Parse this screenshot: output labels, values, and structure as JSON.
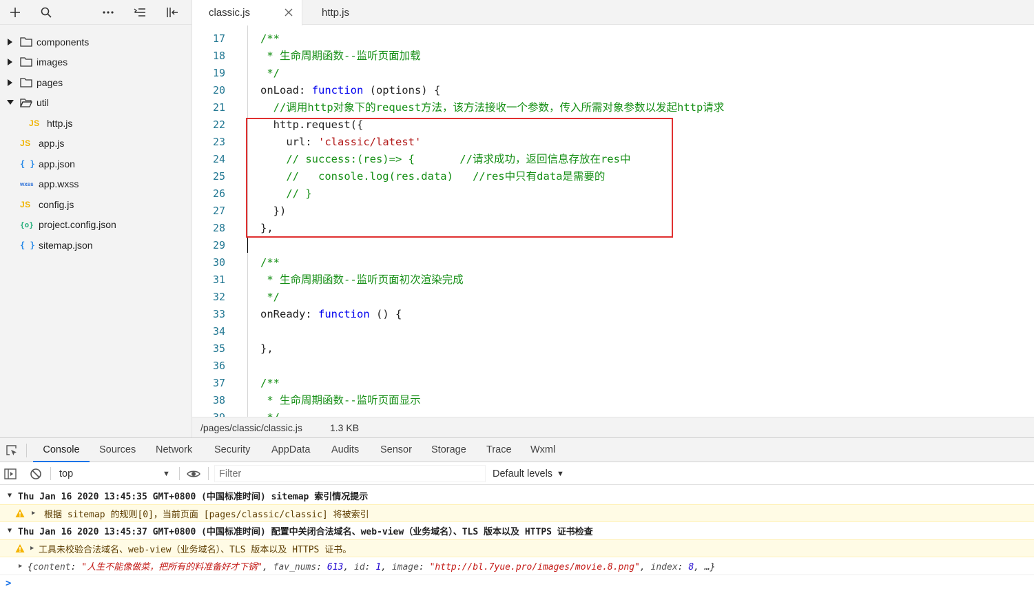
{
  "sidebar": {
    "toolbar": {
      "add": "add-icon",
      "search": "search-icon",
      "more": "more-icon",
      "collapse": "collapse-all-icon",
      "layout": "toggle-layout-icon"
    },
    "tree": [
      {
        "label": "components",
        "type": "folder",
        "depth": 0,
        "expanded": false
      },
      {
        "label": "images",
        "type": "folder",
        "depth": 0,
        "expanded": false
      },
      {
        "label": "pages",
        "type": "folder",
        "depth": 0,
        "expanded": false
      },
      {
        "label": "util",
        "type": "folder",
        "depth": 0,
        "expanded": true
      },
      {
        "label": "http.js",
        "type": "js",
        "depth": 1,
        "badge": "JS"
      },
      {
        "label": "app.js",
        "type": "js",
        "depth": 0,
        "badge": "JS"
      },
      {
        "label": "app.json",
        "type": "json",
        "depth": 0,
        "badge": "{ }"
      },
      {
        "label": "app.wxss",
        "type": "wxss",
        "depth": 0,
        "badge": "wxss"
      },
      {
        "label": "config.js",
        "type": "js",
        "depth": 0,
        "badge": "JS"
      },
      {
        "label": "project.config.json",
        "type": "cfg",
        "depth": 0,
        "badge": "{o}"
      },
      {
        "label": "sitemap.json",
        "type": "json",
        "depth": 0,
        "badge": "{ }"
      }
    ]
  },
  "editor": {
    "tabs": [
      {
        "label": "classic.js",
        "active": true
      },
      {
        "label": "http.js",
        "active": false
      }
    ],
    "lines": [
      {
        "n": "17",
        "tokens": [
          {
            "t": "/**",
            "c": "c-com"
          }
        ]
      },
      {
        "n": "18",
        "tokens": [
          {
            "t": " * 生命周期函数--监听页面加载",
            "c": "c-com"
          }
        ]
      },
      {
        "n": "19",
        "tokens": [
          {
            "t": " */",
            "c": "c-com"
          }
        ]
      },
      {
        "n": "20",
        "tokens": [
          {
            "t": "onLoad: ",
            "c": ""
          },
          {
            "t": "function",
            "c": "c-kw"
          },
          {
            "t": " (options) {",
            "c": ""
          }
        ]
      },
      {
        "n": "21",
        "tokens": [
          {
            "t": "  //调用http对象下的request方法，该方法接收一个参数，传入所需对象参数以发起http请求",
            "c": "c-com"
          }
        ]
      },
      {
        "n": "22",
        "tokens": [
          {
            "t": "  http.request({",
            "c": ""
          }
        ]
      },
      {
        "n": "23",
        "tokens": [
          {
            "t": "    url: ",
            "c": ""
          },
          {
            "t": "'classic/latest'",
            "c": "c-str"
          }
        ]
      },
      {
        "n": "24",
        "tokens": [
          {
            "t": "    // success:(res)=> {       //请求成功，返回信息存放在res中",
            "c": "c-com"
          }
        ]
      },
      {
        "n": "25",
        "tokens": [
          {
            "t": "    //   console.log(res.data)   //res中只有data是需要的",
            "c": "c-com"
          }
        ]
      },
      {
        "n": "26",
        "tokens": [
          {
            "t": "    // }",
            "c": "c-com"
          }
        ]
      },
      {
        "n": "27",
        "tokens": [
          {
            "t": "  })",
            "c": ""
          }
        ]
      },
      {
        "n": "28",
        "tokens": [
          {
            "t": "},",
            "c": ""
          }
        ]
      },
      {
        "n": "29",
        "tokens": []
      },
      {
        "n": "30",
        "tokens": [
          {
            "t": "/**",
            "c": "c-com"
          }
        ]
      },
      {
        "n": "31",
        "tokens": [
          {
            "t": " * 生命周期函数--监听页面初次渲染完成",
            "c": "c-com"
          }
        ]
      },
      {
        "n": "32",
        "tokens": [
          {
            "t": " */",
            "c": "c-com"
          }
        ]
      },
      {
        "n": "33",
        "tokens": [
          {
            "t": "onReady: ",
            "c": ""
          },
          {
            "t": "function",
            "c": "c-kw"
          },
          {
            "t": " () {",
            "c": ""
          }
        ]
      },
      {
        "n": "34",
        "tokens": []
      },
      {
        "n": "35",
        "tokens": [
          {
            "t": "},",
            "c": ""
          }
        ]
      },
      {
        "n": "36",
        "tokens": []
      },
      {
        "n": "37",
        "tokens": [
          {
            "t": "/**",
            "c": "c-com"
          }
        ]
      },
      {
        "n": "38",
        "tokens": [
          {
            "t": " * 生命周期函数--监听页面显示",
            "c": "c-com"
          }
        ]
      },
      {
        "n": "39",
        "tokens": [
          {
            "t": " */",
            "c": "c-com"
          }
        ]
      }
    ],
    "status": {
      "path": "/pages/classic/classic.js",
      "size": "1.3 KB"
    }
  },
  "devtools": {
    "tabs": [
      "Console",
      "Sources",
      "Network",
      "Security",
      "AppData",
      "Audits",
      "Sensor",
      "Storage",
      "Trace",
      "Wxml"
    ],
    "active_tab": "Console",
    "toolbar": {
      "context": "top",
      "filter_placeholder": "Filter",
      "levels": "Default levels"
    },
    "messages": {
      "group1": "Thu Jan 16 2020 13:45:35 GMT+0800 (中国标准时间) sitemap 索引情况提示",
      "warn1": "根据 sitemap 的规则[0]，当前页面 [pages/classic/classic] 将被索引",
      "group2": "Thu Jan 16 2020 13:45:37 GMT+0800 (中国标准时间) 配置中关闭合法域名、web-view（业务域名）、TLS 版本以及 HTTPS 证书检查",
      "warn2": "工具未校验合法域名、web-view（业务域名）、TLS 版本以及 HTTPS 证书。",
      "log": {
        "content_key": "content",
        "content_val": "\"人生不能像做菜，把所有的料准备好才下锅\"",
        "fav_key": "fav_nums",
        "fav_val": "613",
        "id_key": "id",
        "id_val": "1",
        "image_key": "image",
        "image_val": "\"http://bl.7yue.pro/images/movie.8.png\"",
        "index_key": "index",
        "index_val": "8",
        "ellipsis": "…"
      },
      "prompt": ">"
    }
  }
}
